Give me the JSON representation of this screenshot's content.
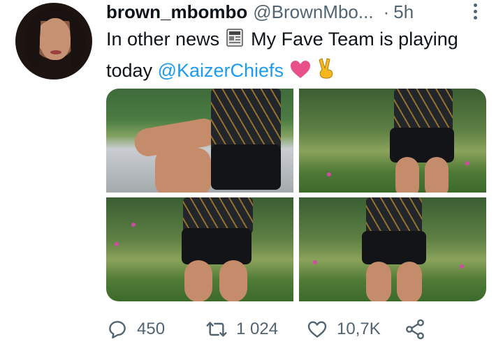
{
  "tweet": {
    "display_name": "brown_mbombo",
    "handle": "@BrownMbo...",
    "separator": "·",
    "time": "5h",
    "text_before": "In other news",
    "text_middle": "My Fave Team is playing today",
    "mention": "@KaizerChiefs",
    "emojis": [
      "newspaper-emoji",
      "heart-emoji",
      "victory-hand-emoji"
    ],
    "media_count": 4
  },
  "actions": {
    "replies": "450",
    "retweets": "1 024",
    "likes": "10,7K"
  },
  "colors": {
    "accent": "#1d9bf0",
    "text": "#0f1419",
    "secondary": "#536471",
    "heart": "#e0245e",
    "jersey_trim": "#f3b028"
  }
}
